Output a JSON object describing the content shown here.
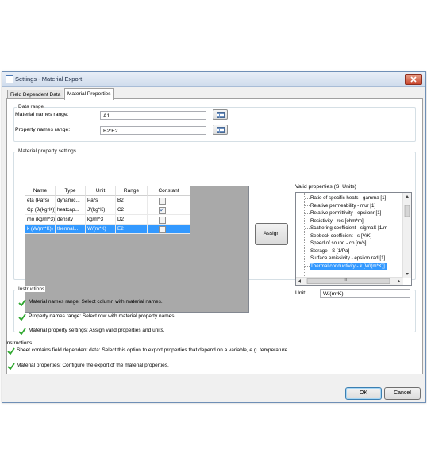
{
  "window": {
    "title": "Settings - Material Export"
  },
  "tabs": [
    {
      "label": "Field Dependent Data",
      "active": false
    },
    {
      "label": "Material Properties",
      "active": true
    }
  ],
  "data_range": {
    "group_label": "Data range",
    "material_names_label": "Material names range:",
    "material_names_value": "A1",
    "property_names_label": "Property names range:",
    "property_names_value": "B2:E2"
  },
  "material_property_settings": {
    "group_label": "Material property settings",
    "columns": [
      "Name",
      "Type",
      "Unit",
      "Range",
      "Constant"
    ],
    "rows": [
      {
        "name": "eta (Pa*s)",
        "type": "dynamic...",
        "unit": "Pa*s",
        "range": "B2",
        "constant": false,
        "selected": false
      },
      {
        "name": "Cp (J/(kg*K))",
        "type": "heatcap...",
        "unit": "J/(kg*K)",
        "range": "C2",
        "constant": true,
        "selected": false
      },
      {
        "name": "rho (kg/m^3)",
        "type": "density",
        "unit": "kg/m^3",
        "range": "D2",
        "constant": false,
        "selected": false
      },
      {
        "name": "k (W/(m*K))",
        "type": "thermal...",
        "unit": "W/(m*K)",
        "range": "E2",
        "constant": false,
        "selected": true
      }
    ],
    "assign_label": "Assign",
    "valid_properties_label": "Valid properties (SI Units)",
    "valid_properties": [
      {
        "label": "Ratio of specific heats - gamma [1]",
        "selected": false
      },
      {
        "label": "Relative permeability - mur [1]",
        "selected": false
      },
      {
        "label": "Relative permittivity - epsilonr [1]",
        "selected": false
      },
      {
        "label": "Resistivity - res [ohm*m]",
        "selected": false
      },
      {
        "label": "Scattering coefficient - sigmaS [1/m",
        "selected": false
      },
      {
        "label": "Seebeck coefficient - s [V/K]",
        "selected": false
      },
      {
        "label": "Speed of sound - cp [m/s]",
        "selected": false
      },
      {
        "label": "Storage - S [1/Pa]",
        "selected": false
      },
      {
        "label": "Surface emissivity - epsilon rad [1]",
        "selected": false
      },
      {
        "label": "Thermal conductivity - k [W/(m*K)]",
        "selected": true
      }
    ],
    "hscroll_thumb": "III",
    "unit_label": "Unit:",
    "unit_value": "W/(m*K)"
  },
  "inner_instructions": {
    "label": "Instructions",
    "items": [
      "Material names range: Select column with material names.",
      "Property names range: Select row with material property names.",
      "Material property settings: Assign valid properties and units."
    ]
  },
  "outer_instructions": {
    "label": "Instructions",
    "items": [
      "Sheet contains field dependent data: Select this option to export properties that depend on a variable, e.g. temperature.",
      "Material properties: Configure the export of the material properties."
    ]
  },
  "footer": {
    "ok_label": "OK",
    "cancel_label": "Cancel"
  },
  "colors": {
    "selection": "#3399ff",
    "check_green": "#2fa82f",
    "title_text": "#1c2b45"
  }
}
